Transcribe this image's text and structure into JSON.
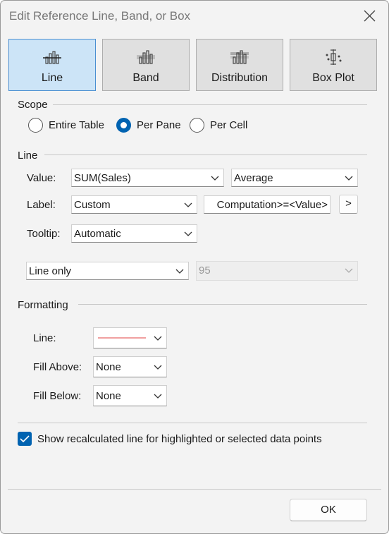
{
  "window": {
    "title": "Edit Reference Line, Band, or Box"
  },
  "types": [
    {
      "label": "Line",
      "icon": "line-chart-icon",
      "selected": true
    },
    {
      "label": "Band",
      "icon": "band-chart-icon",
      "selected": false
    },
    {
      "label": "Distribution",
      "icon": "distribution-chart-icon",
      "selected": false
    },
    {
      "label": "Box Plot",
      "icon": "box-plot-icon",
      "selected": false
    }
  ],
  "scope": {
    "heading": "Scope",
    "options": [
      "Entire Table",
      "Per Pane",
      "Per Cell"
    ],
    "selected": "Per Pane"
  },
  "line": {
    "heading": "Line",
    "value_label": "Value:",
    "value_field": "SUM(Sales)",
    "aggregation": "Average",
    "label_label": "Label:",
    "label_mode": "Custom",
    "label_text": "Computation>=<Value>",
    "label_insert_button": ">",
    "tooltip_label": "Tooltip:",
    "tooltip_mode": "Automatic",
    "line_mode": "Line only",
    "confidence_value": "95"
  },
  "formatting": {
    "heading": "Formatting",
    "line_label": "Line:",
    "line_color": "#f0a0a0",
    "fill_above_label": "Fill Above:",
    "fill_above": "None",
    "fill_below_label": "Fill Below:",
    "fill_below": "None"
  },
  "recalc": {
    "label": "Show recalculated line for highlighted or selected data points",
    "checked": true
  },
  "footer": {
    "ok_label": "OK"
  },
  "colors": {
    "accent": "#0063b1",
    "selected_tile": "#cce4f7",
    "tile_border": "#4a8fd1"
  }
}
